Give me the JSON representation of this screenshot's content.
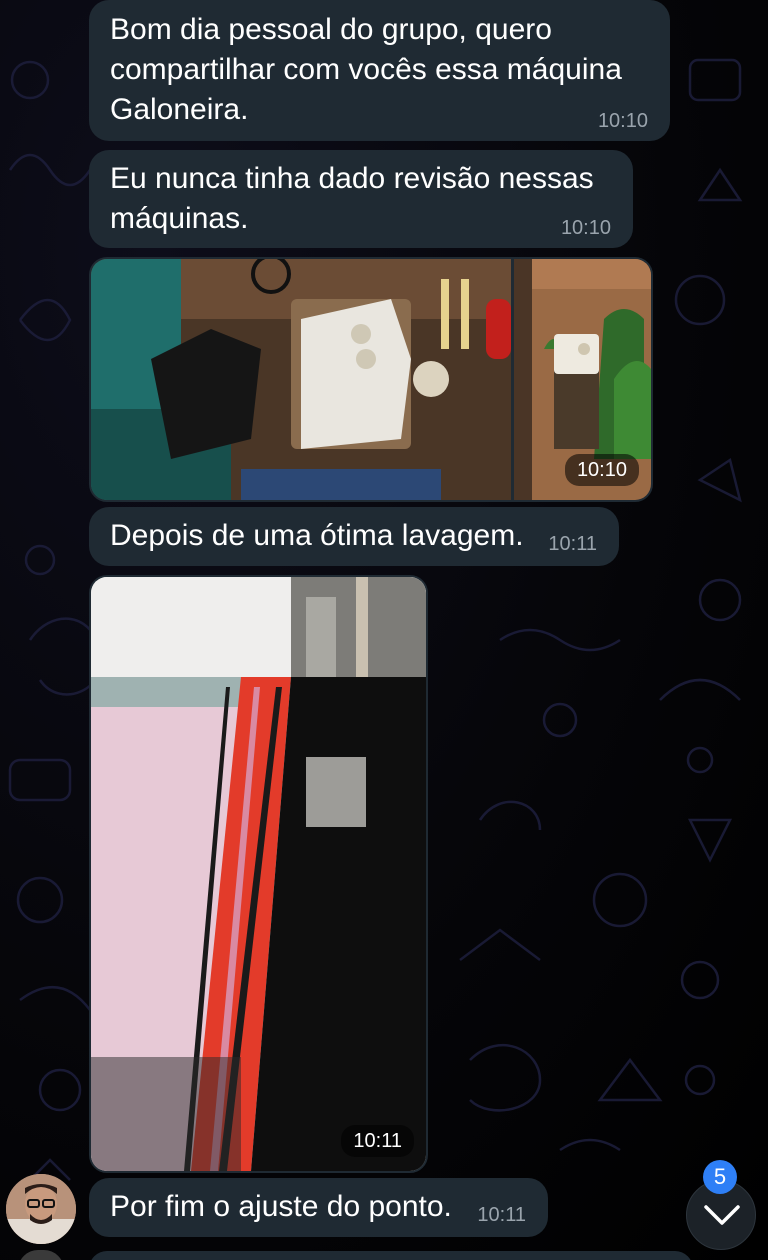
{
  "messages": [
    {
      "text": "Bom dia pessoal do grupo, quero\ncompartilhar com vocês essa máquina\nGaloneira.",
      "time": "10:10"
    },
    {
      "text": "Eu nunca tinha dado revisão nessas\nmáquinas.",
      "time": "10:10"
    },
    {
      "text": "Depois de uma ótima lavagem.",
      "time": "10:11"
    },
    {
      "text": "Por fim o ajuste do ponto.",
      "time": "10:11"
    }
  ],
  "media": [
    {
      "time": "10:10",
      "photos": [
        "sewing-machines-workshop-photo",
        "machine-on-tree-stump-photo"
      ]
    },
    {
      "time": "10:11",
      "photos": [
        "fabric-seam-closeup-photo"
      ]
    }
  ],
  "scroll_button": {
    "unread_count": "5",
    "icon": "chevron-down-icon"
  },
  "colors": {
    "bubble": "#1f2a33",
    "text": "#ffffff",
    "time": "#9aa4ad",
    "badge": "#2e7ff6",
    "background": "#000000"
  }
}
